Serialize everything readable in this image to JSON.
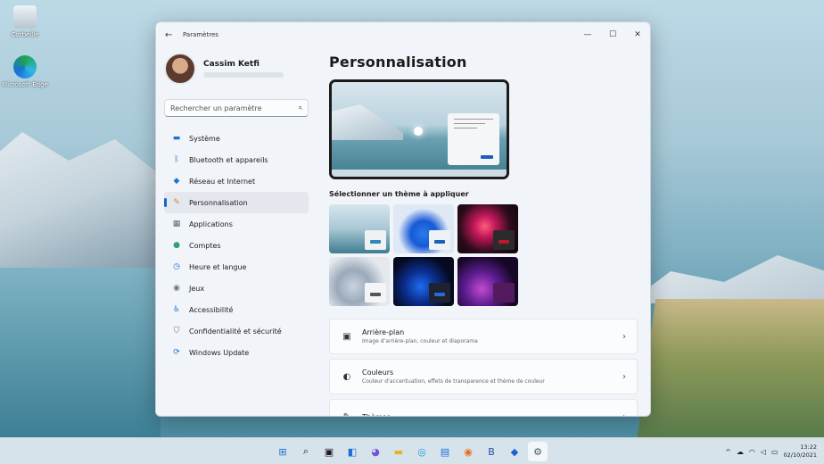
{
  "desktop": {
    "icons": [
      {
        "label": "Corbeille",
        "name": "recycle-bin"
      },
      {
        "label": "Microsoft Edge",
        "name": "edge"
      }
    ]
  },
  "window": {
    "title": "Paramètres",
    "back_glyph": "←",
    "minimize_glyph": "—",
    "maximize_glyph": "☐",
    "close_glyph": "✕"
  },
  "profile": {
    "name": "Cassim Ketfi"
  },
  "search": {
    "placeholder": "Rechercher un paramètre"
  },
  "nav": {
    "items": [
      {
        "label": "Système",
        "icon": "system-icon",
        "glyph": "▬",
        "color": "#1a73d9"
      },
      {
        "label": "Bluetooth et appareils",
        "icon": "bluetooth-icon",
        "glyph": "ᛒ",
        "color": "#1a73d9"
      },
      {
        "label": "Réseau et Internet",
        "icon": "network-icon",
        "glyph": "◆",
        "color": "#1a73d9"
      },
      {
        "label": "Personnalisation",
        "icon": "brush-icon",
        "glyph": "✎",
        "color": "#d9882a"
      },
      {
        "label": "Applications",
        "icon": "apps-icon",
        "glyph": "▦",
        "color": "#5a6a7a"
      },
      {
        "label": "Comptes",
        "icon": "accounts-icon",
        "glyph": "●",
        "color": "#2fa36b"
      },
      {
        "label": "Heure et langue",
        "icon": "time-language-icon",
        "glyph": "◷",
        "color": "#1a73d9"
      },
      {
        "label": "Jeux",
        "icon": "gaming-icon",
        "glyph": "◉",
        "color": "#6a7580"
      },
      {
        "label": "Accessibilité",
        "icon": "accessibility-icon",
        "glyph": "♿",
        "color": "#1a73d9"
      },
      {
        "label": "Confidentialité et sécurité",
        "icon": "shield-icon",
        "glyph": "⛉",
        "color": "#6a7580"
      },
      {
        "label": "Windows Update",
        "icon": "windows-update-icon",
        "glyph": "⟳",
        "color": "#1a73d9"
      }
    ],
    "active_index": 3
  },
  "main": {
    "title": "Personnalisation",
    "themes_label": "Sélectionner un thème à appliquer",
    "cards": [
      {
        "title": "Arrière-plan",
        "subtitle": "Image d’arrière-plan, couleur et diaporama",
        "icon": "image-icon",
        "glyph": "▣"
      },
      {
        "title": "Couleurs",
        "subtitle": "Couleur d’accentuation, effets de transparence et thème de couleur",
        "icon": "palette-icon",
        "glyph": "◐"
      },
      {
        "title": "Thèmes",
        "subtitle": "",
        "icon": "brush-icon",
        "glyph": "✎"
      }
    ],
    "chevron": "›"
  },
  "taskbar": {
    "apps": [
      {
        "name": "start-icon",
        "glyph": "⊞",
        "color": "#1a6fd6"
      },
      {
        "name": "search-icon",
        "glyph": "⌕",
        "color": "#1b1b1b"
      },
      {
        "name": "task-view-icon",
        "glyph": "▣",
        "color": "#1b1b1b"
      },
      {
        "name": "widgets-icon",
        "glyph": "◧",
        "color": "#1a6fd6"
      },
      {
        "name": "chat-icon",
        "glyph": "◕",
        "color": "#6b57d6"
      },
      {
        "name": "file-explorer-icon",
        "glyph": "▬",
        "color": "#e8b12a"
      },
      {
        "name": "edge-icon",
        "glyph": "◎",
        "color": "#1a9ad6"
      },
      {
        "name": "store-icon",
        "glyph": "▤",
        "color": "#1a6fd6"
      },
      {
        "name": "firefox-icon",
        "glyph": "◉",
        "color": "#e86a1a"
      },
      {
        "name": "bitwarden-icon",
        "glyph": "B",
        "color": "#1b4f9c"
      },
      {
        "name": "dropbox-icon",
        "glyph": "◆",
        "color": "#1a5fd6"
      },
      {
        "name": "settings-icon",
        "glyph": "⚙",
        "color": "#4a5a6a"
      }
    ],
    "active_index": 11,
    "tray": {
      "chevron": "^",
      "time": "13:22",
      "date": "02/10/2021"
    }
  }
}
